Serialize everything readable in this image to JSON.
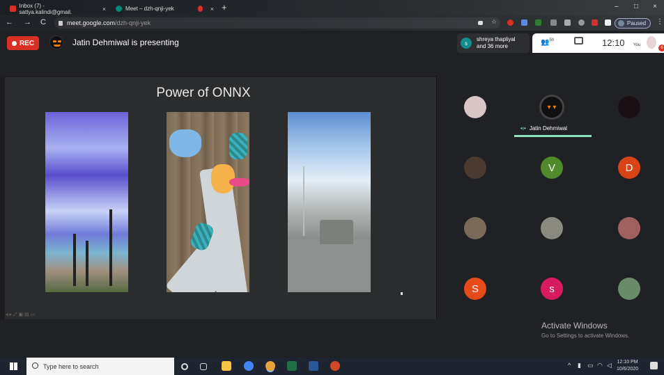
{
  "browser": {
    "tabs": [
      {
        "title": "Inbox (7) - sattya.kalindi@gmail.",
        "favicon_color": "#d93025"
      },
      {
        "title": "Meet – dzh-qnji-yek",
        "favicon_color": "#00897b"
      },
      {
        "title": "",
        "favicon_color": "#d93025"
      }
    ],
    "new_tab_label": "+",
    "url_host": "meet.google.com",
    "url_path": "/dzh-qnji-yek",
    "profile_label": "Paused",
    "window_controls": {
      "minimize": "–",
      "maximize": "□",
      "close": "×"
    },
    "nav": {
      "back": "←",
      "forward": "→",
      "reload": "C"
    }
  },
  "meet": {
    "rec_label": "REC",
    "presenter_text": "Jatin Dehmiwal is presenting",
    "joined_initial": "s",
    "joined_line1": "shreya thapliyal",
    "joined_line2": "and 36 more",
    "people_count": "50",
    "time": "12:10",
    "you_label": "You",
    "notification_badge": "6",
    "slide_title": "Power of ONNX",
    "active_speaker": "Jatin Dehmiwal",
    "speaking_color": "#8ee2c1",
    "participants": [
      {
        "initial": "",
        "color": "#d9c7c7",
        "kind": "photo"
      },
      {
        "initial": "",
        "color": "#111111",
        "kind": "photo"
      },
      {
        "initial": "",
        "color": "#1a1014",
        "kind": "dark"
      },
      {
        "initial": "",
        "color": "#4a3a30",
        "kind": "photo"
      },
      {
        "initial": "V",
        "color": "#4f8a2b",
        "kind": "letter"
      },
      {
        "initial": "D",
        "color": "#d84315",
        "kind": "letter"
      },
      {
        "initial": "",
        "color": "#7a6a5a",
        "kind": "photo"
      },
      {
        "initial": "",
        "color": "#8a8a80",
        "kind": "photo"
      },
      {
        "initial": "",
        "color": "#a06060",
        "kind": "photo"
      },
      {
        "initial": "S",
        "color": "#e64a19",
        "kind": "letter"
      },
      {
        "initial": "s",
        "color": "#d81b60",
        "kind": "letter"
      },
      {
        "initial": "",
        "color": "#6a8a6a",
        "kind": "photo"
      }
    ]
  },
  "windows": {
    "activate_title": "Activate Windows",
    "activate_sub": "Go to Settings to activate Windows.",
    "search_placeholder": "Type here to search",
    "clock_time": "12:10 PM",
    "clock_date": "10/6/2020"
  }
}
